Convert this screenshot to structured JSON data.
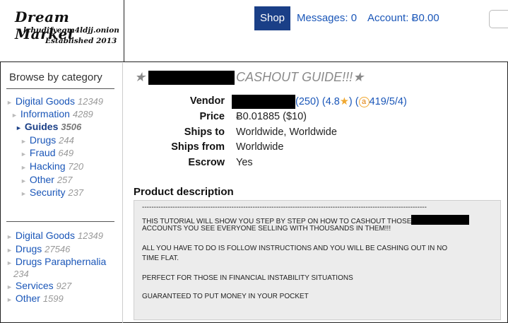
{
  "header": {
    "logo_title": "Dream Market",
    "logo_onion": "lchudifyeqm4ldjj.onion",
    "logo_established": "Established 2013",
    "nav": {
      "shop": "Shop",
      "messages": "Messages: 0",
      "account": "Account: Ƀ0.00"
    }
  },
  "sidebar": {
    "title": "Browse by category",
    "tree": [
      {
        "label": "Digital Goods",
        "count": "12349"
      },
      {
        "label": "Information",
        "count": "4289"
      },
      {
        "label": "Guides",
        "count": "3506",
        "active": true
      },
      {
        "label": "Drugs",
        "count": "244"
      },
      {
        "label": "Fraud",
        "count": "649"
      },
      {
        "label": "Hacking",
        "count": "720"
      },
      {
        "label": "Other",
        "count": "257"
      },
      {
        "label": "Security",
        "count": "237"
      }
    ],
    "top_categories": [
      {
        "label": "Digital Goods",
        "count": "12349"
      },
      {
        "label": "Drugs",
        "count": "27546"
      },
      {
        "label": "Drugs Paraphernalia",
        "count": "234"
      },
      {
        "label": "Services",
        "count": "927"
      },
      {
        "label": "Other",
        "count": "1599"
      }
    ]
  },
  "listing": {
    "star_prefix": "★",
    "title_text": "CASHOUT GUIDE!!!★",
    "labels": {
      "vendor": "Vendor",
      "price": "Price",
      "ships_to": "Ships to",
      "ships_from": "Ships from",
      "escrow": "Escrow"
    },
    "vendor": {
      "rating_count": "(250)",
      "rating_open": "(4.8",
      "rating_close": ")",
      "trust_open": "(",
      "trust_badge": "a",
      "trust_stats": "419/5/4)"
    },
    "price": "Ƀ0.01885 ($10)",
    "ships_to": "Worldwide, Worldwide",
    "ships_from": "Worldwide",
    "escrow": "Yes"
  },
  "description": {
    "heading": "Product description",
    "separator": "-------------------------------------------------------------------------------------------------------------------------",
    "line1": "THIS TUTORIAL WILL SHOW YOU STEP BY STEP ON HOW TO CASHOUT THOSE",
    "line2": "ACCOUNTS YOU SEE EVERYONE SELLING WITH THOUSANDS IN THEM!!!",
    "line3": "ALL YOU HAVE TO DO IS FOLLOW INSTRUCTIONS AND YOU WILL BE CASHING OUT IN NO",
    "line4": "TIME FLAT.",
    "line5": "PERFECT FOR THOSE IN FINANCIAL INSTABILITY SITUATIONS",
    "line6": "GUARANTEED TO PUT MONEY IN YOUR POCKET"
  }
}
